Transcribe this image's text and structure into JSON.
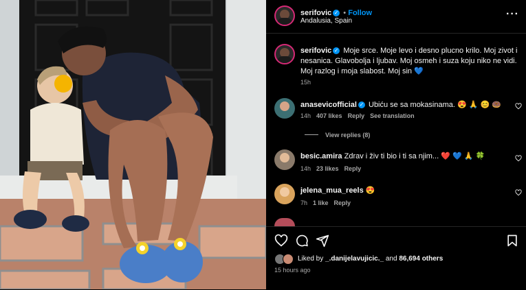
{
  "post": {
    "username": "serifovic",
    "follow_label": "Follow",
    "location": "Andalusia, Spain",
    "more_icon": "more-horizontal-icon",
    "caption": "Moje srce. Moje levo i desno plucno krilo. Moj zivot i nesanica. Glavobolja i ljubav. Moj osmeh i suza koju niko ne vidi. Moj razlog i moja slabost. Moj sin 💙",
    "caption_time": "15h"
  },
  "comments": [
    {
      "username": "anasevicofficial",
      "verified": true,
      "text": "Ubiću se sa mokasinama. 😍 🙏 😊 🍩",
      "time": "14h",
      "likes": "407 likes",
      "reply": "Reply",
      "translation": "See translation",
      "view_replies": "View replies (8)"
    },
    {
      "username": "besic.amira",
      "verified": false,
      "text": "Zdrav i živ ti bio i ti sa njim... ❤️ 💙 🙏 🍀",
      "time": "14h",
      "likes": "23 likes",
      "reply": "Reply"
    },
    {
      "username": "jelena_mua_reels",
      "verified": false,
      "text": "😍",
      "time": "7h",
      "likes": "1 like",
      "reply": "Reply"
    }
  ],
  "footer": {
    "liked_by_prefix": "Liked by",
    "liked_by_user": "_.danijelavujicic._",
    "liked_by_and": "and",
    "liked_by_count": "86,694 others",
    "timestamp": "15 hours ago"
  },
  "colors": {
    "accent": "#0095f6",
    "heart": "#ed4956",
    "muted": "#a8a8a8"
  }
}
